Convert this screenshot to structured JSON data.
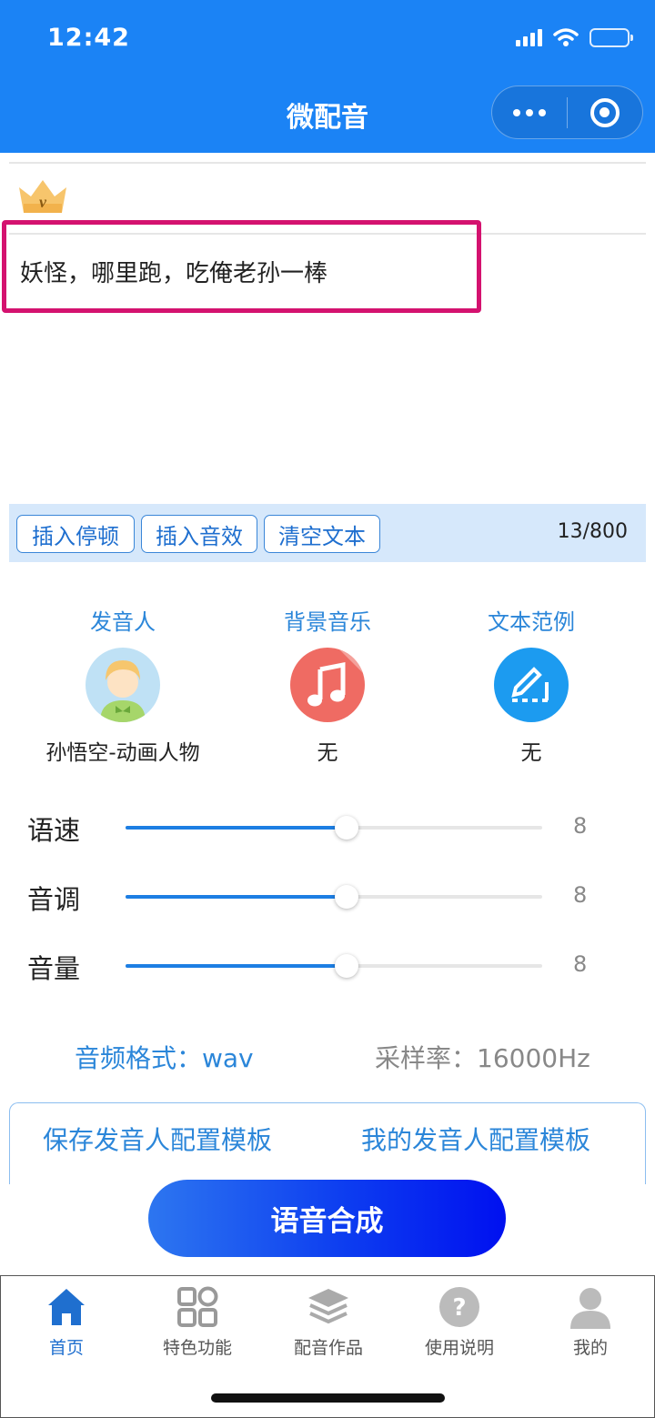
{
  "status_bar": {
    "time": "12:42"
  },
  "header": {
    "title": "微配音"
  },
  "editor": {
    "text": "妖怪，哪里跑，吃俺老孙一棒"
  },
  "toolbar": {
    "insert_pause": "插入停顿",
    "insert_sound": "插入音效",
    "clear_text": "清空文本",
    "char_count": "13/800"
  },
  "options": [
    {
      "label": "发音人",
      "value": "孙悟空-动画人物",
      "icon": "boy-avatar-icon"
    },
    {
      "label": "背景音乐",
      "value": "无",
      "icon": "music-note-icon"
    },
    {
      "label": "文本范例",
      "value": "无",
      "icon": "edit-pen-icon"
    }
  ],
  "sliders": [
    {
      "label": "语速",
      "value": "8",
      "level": 0.53
    },
    {
      "label": "音调",
      "value": "8",
      "level": 0.53
    },
    {
      "label": "音量",
      "value": "8",
      "level": 0.53
    }
  ],
  "format": {
    "audio_format": "音频格式：wav",
    "sample_rate": "采样率：16000Hz"
  },
  "templates": {
    "save": "保存发音人配置模板",
    "mine": "我的发音人配置模板"
  },
  "synthesize_label": "语音合成",
  "tabs": [
    {
      "label": "首页",
      "icon": "home-icon",
      "active": true
    },
    {
      "label": "特色功能",
      "icon": "grid-icon",
      "active": false
    },
    {
      "label": "配音作品",
      "icon": "layers-icon",
      "active": false
    },
    {
      "label": "使用说明",
      "icon": "question-icon",
      "active": false
    },
    {
      "label": "我的",
      "icon": "user-icon",
      "active": false
    }
  ],
  "colors": {
    "brand_blue": "#1b83f5",
    "link_blue": "#2b86d9",
    "highlight_border": "#d4126f",
    "toolbar_bg": "#d6e8fb"
  }
}
